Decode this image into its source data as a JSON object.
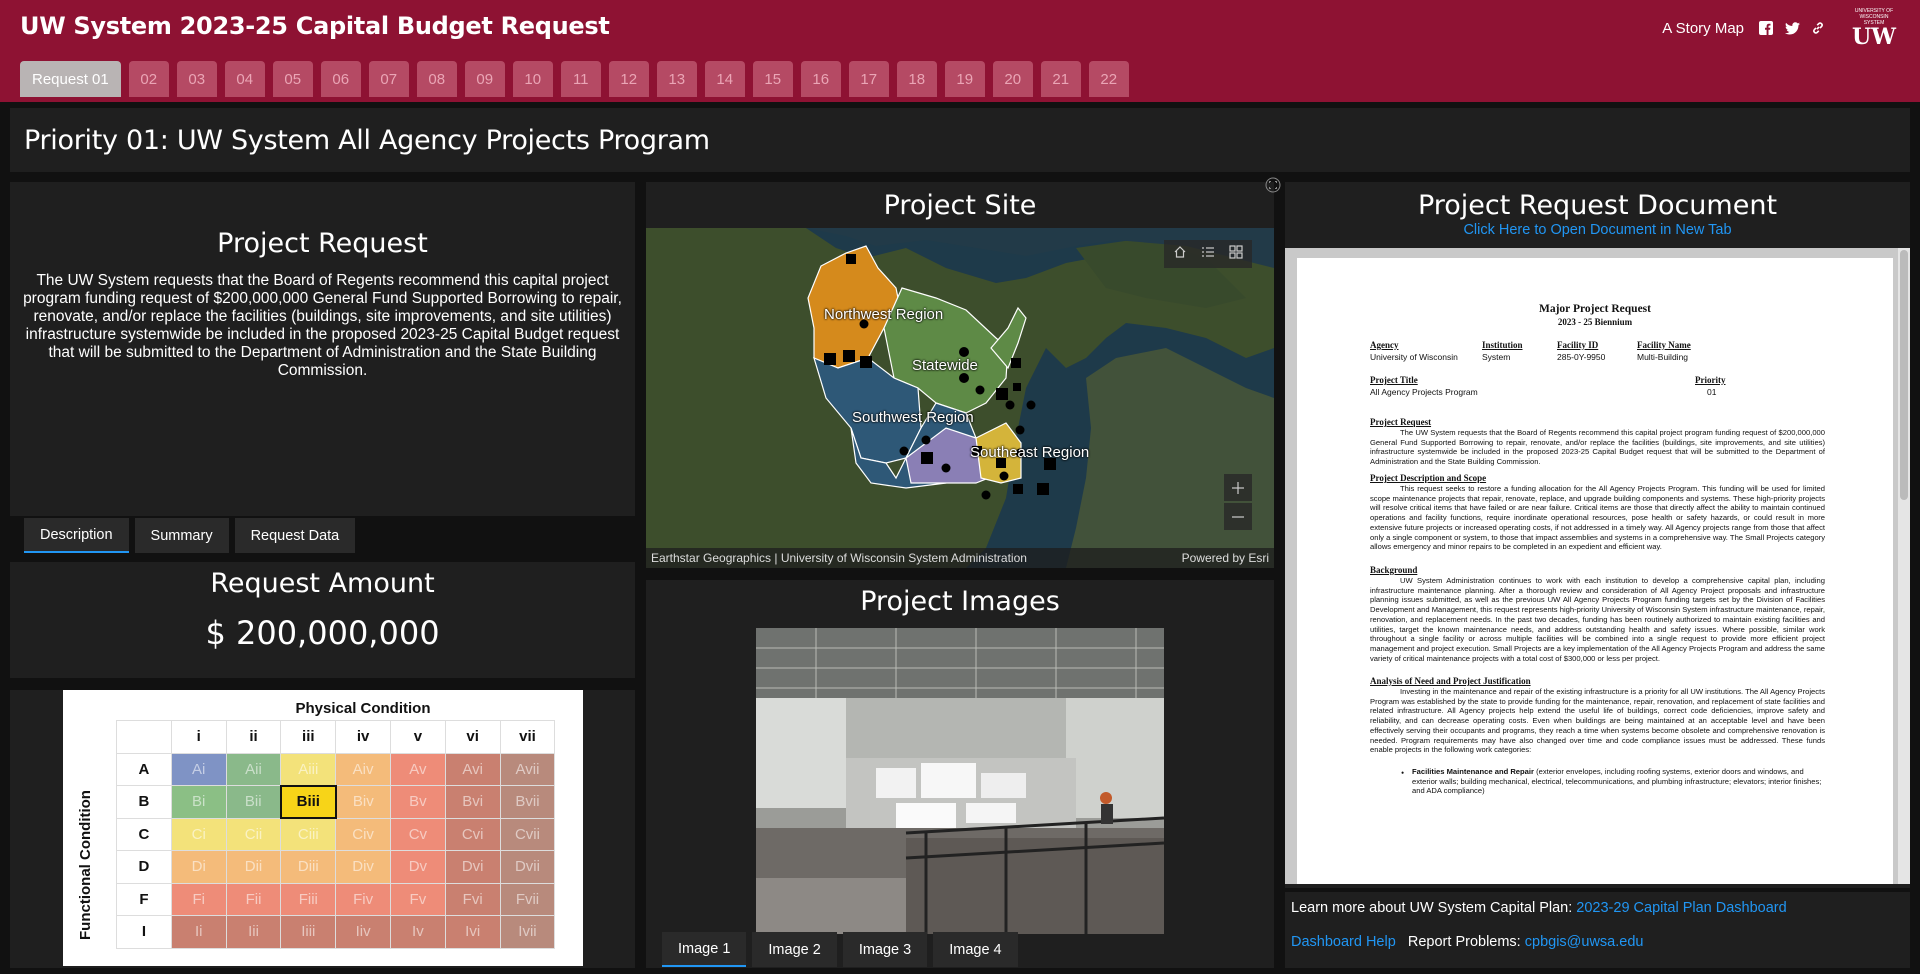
{
  "header": {
    "title": "UW System 2023-25 Capital Budget Request",
    "story_map": "A Story Map",
    "logo_small": "UNIVERSITY OF WISCONSIN SYSTEM",
    "logo_big": "UW",
    "tabs": [
      "Request 01",
      "02",
      "03",
      "04",
      "05",
      "06",
      "07",
      "08",
      "09",
      "10",
      "11",
      "12",
      "13",
      "14",
      "15",
      "16",
      "17",
      "18",
      "19",
      "20",
      "21",
      "22"
    ]
  },
  "priority": {
    "title": "Priority 01: UW System All Agency Projects Program"
  },
  "request": {
    "heading": "Project Request",
    "body": "The UW System requests that the Board of Regents recommend this capital project program funding request of $200,000,000 General Fund Supported Borrowing to repair, renovate, and/or replace the facilities (buildings, site improvements, and site utilities) infrastructure systemwide be included in the proposed 2023-25 Capital Budget request that will be submitted to the Department of Administration and the State Building Commission.",
    "tabs": [
      "Description",
      "Summary",
      "Request Data"
    ]
  },
  "amount": {
    "heading": "Request Amount",
    "value": "$ 200,000,000"
  },
  "condition": {
    "title": "Physical Condition",
    "y_label": "Functional Condition",
    "cols": [
      "i",
      "ii",
      "iii",
      "iv",
      "v",
      "vi",
      "vii"
    ],
    "rows": [
      "A",
      "B",
      "C",
      "D",
      "F",
      "I"
    ],
    "cells": [
      [
        "Ai",
        "Aii",
        "Aiii",
        "Aiv",
        "Av",
        "Avi",
        "Avii"
      ],
      [
        "Bi",
        "Bii",
        "Biii",
        "Biv",
        "Bv",
        "Bvi",
        "Bvii"
      ],
      [
        "Ci",
        "Cii",
        "Ciii",
        "Civ",
        "Cv",
        "Cvi",
        "Cvii"
      ],
      [
        "Di",
        "Dii",
        "Diii",
        "Div",
        "Dv",
        "Dvi",
        "Dvii"
      ],
      [
        "Fi",
        "Fii",
        "Fiii",
        "Fiv",
        "Fv",
        "Fvi",
        "Fvii"
      ],
      [
        "Ii",
        "Iii",
        "Iiii",
        "Iiv",
        "Iv",
        "Ivi",
        "Ivii"
      ]
    ],
    "selected": "Biii"
  },
  "site": {
    "heading": "Project Site",
    "regions": [
      "Northwest Region",
      "Statewide",
      "Southwest Region",
      "Southeast Region"
    ],
    "attribution": "Earthstar Geographics | University of Wisconsin System Administration",
    "powered": "Powered by Esri"
  },
  "images": {
    "heading": "Project Images",
    "tabs": [
      "Image 1",
      "Image 2",
      "Image 3",
      "Image 4"
    ]
  },
  "document": {
    "heading": "Project Request Document",
    "link": "Click Here to Open Document in New Tab",
    "title": "Major Project Request",
    "biennium": "2023 - 25 Biennium",
    "labels": {
      "agency": "Agency",
      "institution": "Institution",
      "facility_id": "Facility ID",
      "facility_name": "Facility Name",
      "project_title": "Project Title",
      "priority": "Priority"
    },
    "values": {
      "agency": "University of Wisconsin",
      "institution": "System",
      "facility_id": "285-0Y-9950",
      "facility_name": "Multi-Building",
      "project_title": "All Agency Projects Program",
      "priority": "01"
    },
    "sections": {
      "request_h": "Project Request",
      "request_p": "The UW System requests that the Board of Regents recommend this capital project program funding request of $200,000,000 General Fund Supported Borrowing to repair, renovate, and/or replace the facilities (buildings, site improvements, and site utilities) infrastructure systemwide be included in the proposed 2023-25 Capital Budget request that will be submitted to the Department of Administration and the State Building Commission.",
      "scope_h": "Project Description and Scope",
      "scope_p": "This request seeks to restore a funding allocation for the All Agency Projects Program. This funding will be used for limited scope maintenance projects that repair, renovate, replace, and upgrade building components and systems. These high-priority projects will resolve critical items that have failed or are near failure. Critical items are those that directly affect the ability to maintain continued operations and facility functions, require inordinate operational resources, pose health or safety hazards, or could result in more extensive future projects or increased operating costs, if not addressed in a timely way. All Agency projects range from those that affect only a single component or system, to those that impact assemblies and systems in a comprehensive way. The Small Projects category allows emergency and minor repairs to be completed in an expedient and efficient way.",
      "background_h": "Background",
      "background_p": "UW System Administration continues to work with each institution to develop a comprehensive capital plan, including infrastructure maintenance planning. After a thorough review and consideration of All Agency Project proposals and infrastructure planning issues submitted, as well as the previous UW All Agency Projects Program funding targets set by the Division of Facilities Development and Management, this request represents high-priority University of Wisconsin System infrastructure maintenance, repair, renovation, and replacement needs. In the past two decades, funding has been routinely authorized to maintain existing facilities and utilities, target the known maintenance needs, and address outstanding health and safety issues. Where possible, similar work throughout a single facility or across multiple facilities will be combined into a single request to provide more efficient project management and project execution. Small Projects are a key implementation of the All Agency Projects Program and address the same variety of critical maintenance projects with a total cost of $300,000 or less per project.",
      "analysis_h": "Analysis of Need and Project Justification",
      "analysis_p": "Investing in the maintenance and repair of the existing infrastructure is a priority for all UW institutions. The All Agency Projects Program was established by the state to provide funding for the maintenance, repair, renovation, and replacement of state facilities and related infrastructure. All Agency projects help extend the useful life of buildings, correct code deficiencies, improve safety and reliability, and can decrease operating costs. Even when buildings are being maintained at an acceptable level and have been effectively serving their occupants and programs, they reach a time when systems become obsolete and comprehensive renovation is needed. Program requirements may have also changed over time and code compliance issues must be addressed. These funds enable projects in the following work categories:",
      "bullet_b": "Facilities Maintenance and Repair",
      "bullet_t": " (exterior envelopes, including roofing systems, exterior doors and windows, and exterior walls; building mechanical, electrical, telecommunications, and plumbing infrastructure; elevators; interior finishes; and ADA compliance)"
    }
  },
  "info": {
    "learn_more": "Learn more about UW System Capital Plan: ",
    "dashboard_link": "2023-29 Capital Plan Dashboard",
    "help_link": "Dashboard Help",
    "report": "Report Problems: ",
    "email": "cpbgis@uwsa.edu"
  },
  "colors": {
    "header_bg": "#8e1233",
    "panel_bg": "#1f1f1f",
    "link": "#2196f3"
  },
  "icons": [
    "facebook-icon",
    "twitter-icon",
    "link-icon",
    "home-icon",
    "legend-icon",
    "basemap-icon",
    "zoom-in-icon",
    "zoom-out-icon",
    "expand-icon"
  ]
}
